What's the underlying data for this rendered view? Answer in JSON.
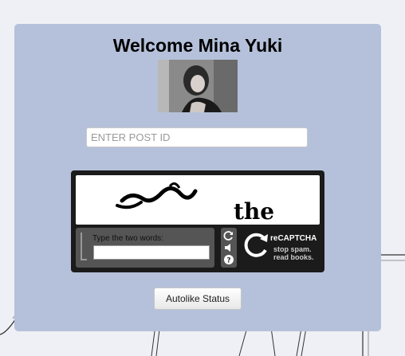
{
  "header": {
    "title": "Welcome Mina Yuki"
  },
  "avatar": {
    "alt": "profile photo"
  },
  "post_input": {
    "placeholder": "ENTER POST ID",
    "value": ""
  },
  "captcha": {
    "instruction": "Type the two words:",
    "brand": "reCAPTCHA",
    "tagline_1": "stop spam.",
    "tagline_2": "read books.",
    "words": [
      "the"
    ],
    "icons": [
      "refresh-icon",
      "audio-icon",
      "help-icon"
    ]
  },
  "submit": {
    "label": "Autolike Status"
  }
}
